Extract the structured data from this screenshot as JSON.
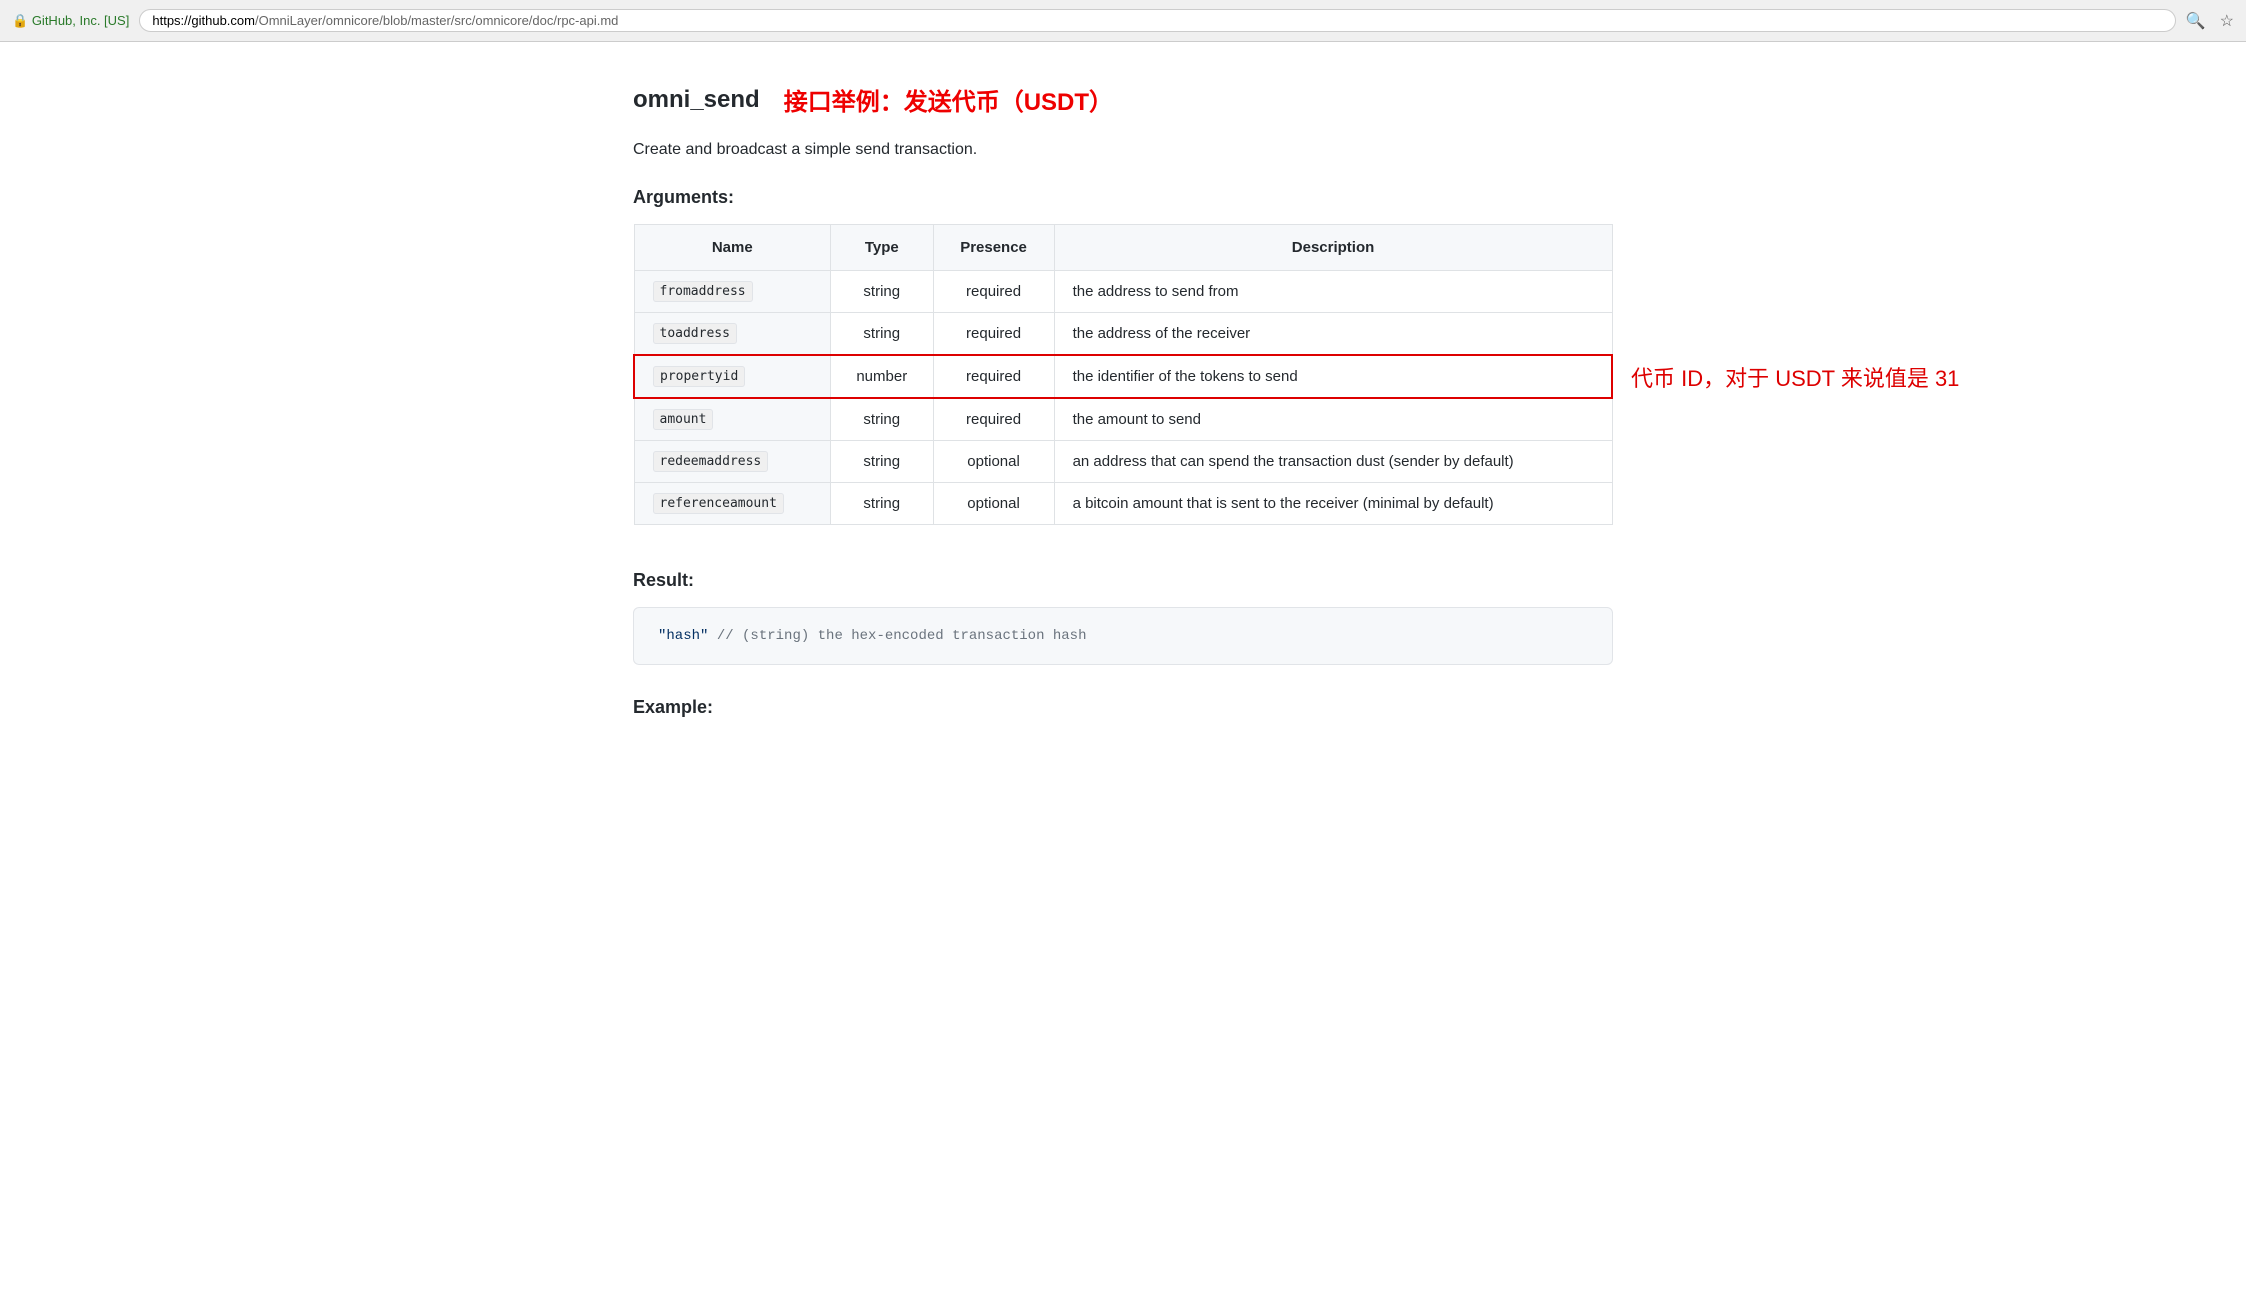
{
  "browser": {
    "lock_label": "GitHub, Inc. [US]",
    "url_origin": "https://github.com",
    "url_path": "/OmniLayer/omnicore/blob/master/src/omnicore/doc/rpc-api.md"
  },
  "page": {
    "api_name": "omni_send",
    "api_subtitle": "接口举例：发送代币（USDT）",
    "api_description": "Create and broadcast a simple send transaction.",
    "arguments_label": "Arguments:",
    "table": {
      "headers": [
        "Name",
        "Type",
        "Presence",
        "Description"
      ],
      "rows": [
        {
          "name": "fromaddress",
          "type": "string",
          "presence": "required",
          "description": "the address to send from",
          "highlighted": false
        },
        {
          "name": "toaddress",
          "type": "string",
          "presence": "required",
          "description": "the address of the receiver",
          "highlighted": false
        },
        {
          "name": "propertyid",
          "type": "number",
          "presence": "required",
          "description": "the identifier of the tokens to send",
          "highlighted": true,
          "annotation": "代币 ID，对于 USDT 来说值是 31"
        },
        {
          "name": "amount",
          "type": "string",
          "presence": "required",
          "description": "the amount to send",
          "highlighted": false
        },
        {
          "name": "redeemaddress",
          "type": "string",
          "presence": "optional",
          "description": "an address that can spend the transaction dust (sender by default)",
          "highlighted": false
        },
        {
          "name": "referenceamount",
          "type": "string",
          "presence": "optional",
          "description": "a bitcoin amount that is sent to the receiver (minimal by default)",
          "highlighted": false
        }
      ]
    },
    "result_label": "Result:",
    "result_code": "\"hash\"  // (string) the hex-encoded transaction hash",
    "example_label": "Example:"
  }
}
